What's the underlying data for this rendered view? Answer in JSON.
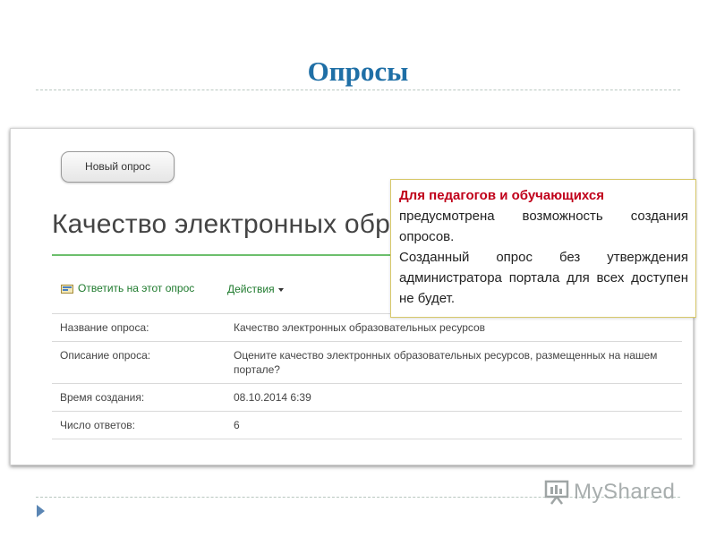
{
  "slide": {
    "title": "Опросы"
  },
  "app": {
    "new_survey_button": "Новый опрос",
    "survey_title": "Качество электронных образовательных ресурсов",
    "reply_link": "Ответить на этот опрос",
    "actions_menu": "Действия"
  },
  "details": {
    "rows": [
      {
        "label": "Название опроса:",
        "value": "Качество электронных образовательных ресурсов"
      },
      {
        "label": "Описание опроса:",
        "value": "Оцените качество электронных образовательных ресурсов, размещенных на нашем портале?"
      },
      {
        "label": "Время создания:",
        "value": "08.10.2014 6:39"
      },
      {
        "label": "Число ответов:",
        "value": "6"
      }
    ]
  },
  "callout": {
    "heading": "Для педагогов и обучающихся",
    "line1": "предусмотрена возможность создания опросов.",
    "line2": "Созданный опрос без утверждения администратора портала для всех доступен не будет."
  },
  "watermark": {
    "text": "MyShared"
  },
  "colors": {
    "title": "#1f6fa6",
    "callout_heading": "#c0001a",
    "link_green": "#1e7a2d",
    "callout_border": "#d7c86a"
  }
}
